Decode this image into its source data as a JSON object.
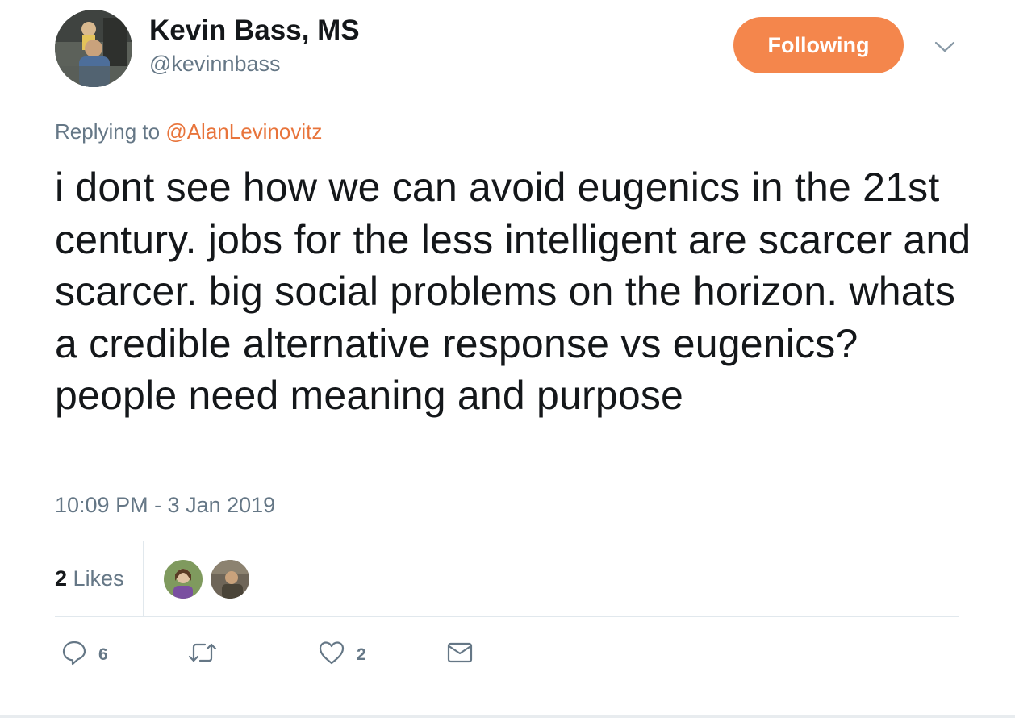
{
  "author": {
    "name": "Kevin Bass, MS",
    "handle": "@kevinnbass"
  },
  "follow_button": {
    "label": "Following",
    "color": "#f4864c"
  },
  "reply": {
    "prefix": "Replying to",
    "mention": "@AlanLevinovitz"
  },
  "tweet": {
    "text": "i dont see how we can avoid eugenics in the 21st century. jobs for the less intelligent are scarcer and scarcer. big social problems on the horizon. whats a credible alternative response vs eugenics? people need meaning and purpose",
    "timestamp": "10:09 PM - 3 Jan 2019"
  },
  "likes": {
    "count": "2",
    "label": "Likes"
  },
  "actions": {
    "reply": {
      "icon": "reply-icon",
      "count": "6"
    },
    "retweet": {
      "icon": "retweet-icon",
      "count": ""
    },
    "like": {
      "icon": "heart-icon",
      "count": "2"
    },
    "message": {
      "icon": "envelope-icon"
    }
  },
  "colors": {
    "accent": "#e8743b",
    "secondary_text": "#657786",
    "primary_text": "#14171a"
  }
}
